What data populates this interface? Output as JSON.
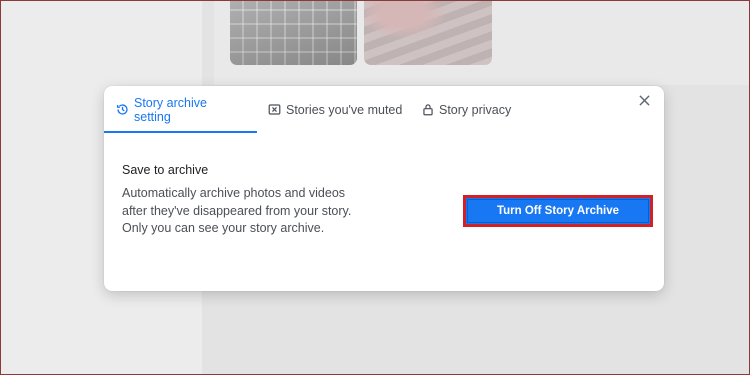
{
  "background": {
    "thumbnails": [
      {
        "name": "keyboard-photo"
      },
      {
        "name": "pink-photo"
      }
    ]
  },
  "dialog": {
    "tabs": [
      {
        "label": "Story archive setting",
        "icon": "clock-history-icon",
        "active": true
      },
      {
        "label": "Stories you've muted",
        "icon": "muted-box-icon",
        "active": false
      },
      {
        "label": "Story privacy",
        "icon": "lock-icon",
        "active": false
      }
    ],
    "close_icon": "close-icon",
    "section_title": "Save to archive",
    "section_description": "Automatically archive photos and videos after they've disappeared from your story. Only you can see your story archive.",
    "turn_off_button": "Turn Off Story Archive"
  },
  "colors": {
    "accent": "#1877f2",
    "highlight_border": "#d0202a",
    "text_primary": "#1c1e21",
    "text_secondary": "#4b4f56"
  }
}
